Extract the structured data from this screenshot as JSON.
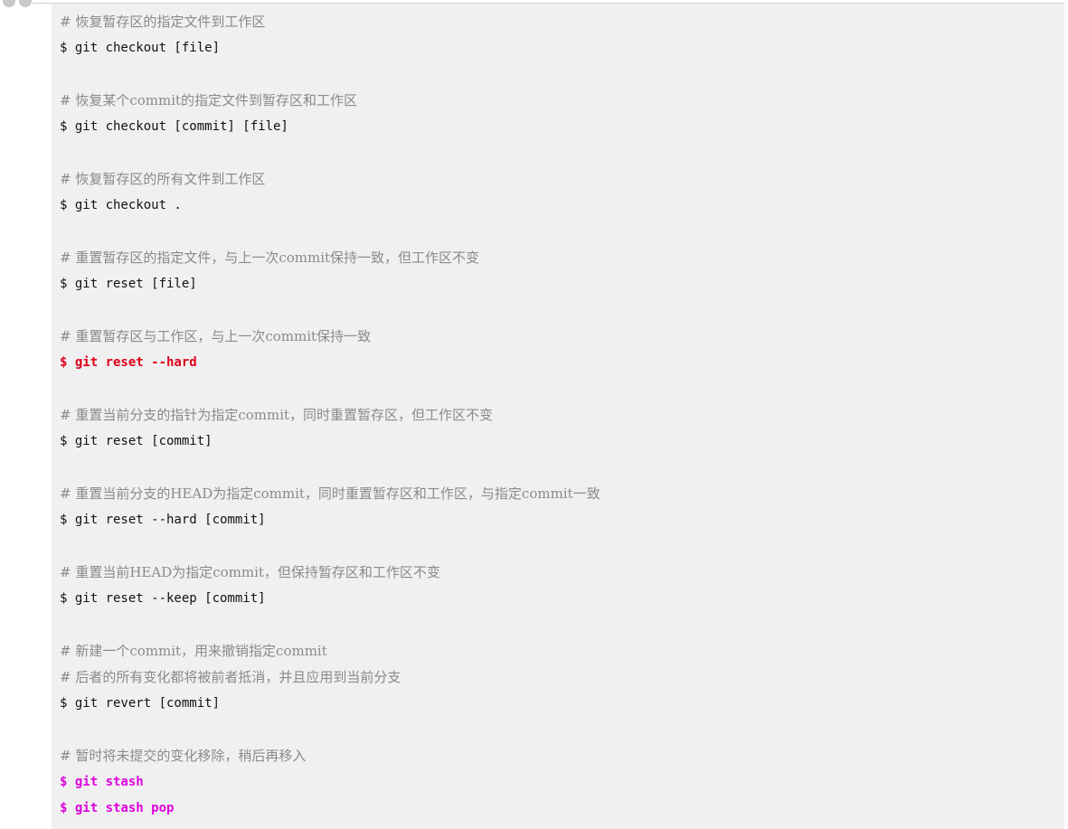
{
  "colors": {
    "block_background": "#f0f0f0",
    "comment": "#8a8a8a",
    "command": "#111111",
    "highlight_red": "#e0001b",
    "highlight_magenta": "#dd00dd"
  },
  "lines": [
    {
      "kind": "comment",
      "text": "# 恢复暂存区的指定文件到工作区"
    },
    {
      "kind": "command",
      "text": "$ git checkout [file]"
    },
    {
      "kind": "comment",
      "text": "# 恢复某个commit的指定文件到暂存区和工作区"
    },
    {
      "kind": "command",
      "text": "$ git checkout [commit] [file]"
    },
    {
      "kind": "comment",
      "text": "# 恢复暂存区的所有文件到工作区"
    },
    {
      "kind": "command",
      "text": "$ git checkout ."
    },
    {
      "kind": "comment",
      "text": "# 重置暂存区的指定文件，与上一次commit保持一致，但工作区不变"
    },
    {
      "kind": "command",
      "text": "$ git reset [file]"
    },
    {
      "kind": "comment",
      "text": "# 重置暂存区与工作区，与上一次commit保持一致"
    },
    {
      "kind": "command",
      "text": "$ git reset --hard",
      "highlight": "red"
    },
    {
      "kind": "comment",
      "text": "# 重置当前分支的指针为指定commit，同时重置暂存区，但工作区不变"
    },
    {
      "kind": "command",
      "text": "$ git reset [commit]"
    },
    {
      "kind": "comment",
      "text": "# 重置当前分支的HEAD为指定commit，同时重置暂存区和工作区，与指定commit一致"
    },
    {
      "kind": "command",
      "text": "$ git reset --hard [commit]"
    },
    {
      "kind": "comment",
      "text": "# 重置当前HEAD为指定commit，但保持暂存区和工作区不变"
    },
    {
      "kind": "command",
      "text": "$ git reset --keep [commit]"
    },
    {
      "kind": "comment",
      "text": "# 新建一个commit，用来撤销指定commit"
    },
    {
      "kind": "comment",
      "text": "# 后者的所有变化都将被前者抵消，并且应用到当前分支"
    },
    {
      "kind": "command",
      "text": "$ git revert [commit]"
    },
    {
      "kind": "comment",
      "text": "# 暂时将未提交的变化移除，稍后再移入"
    },
    {
      "kind": "command",
      "text": "$ git stash",
      "highlight": "magenta"
    },
    {
      "kind": "command",
      "text": "$ git stash pop",
      "highlight": "magenta"
    }
  ]
}
